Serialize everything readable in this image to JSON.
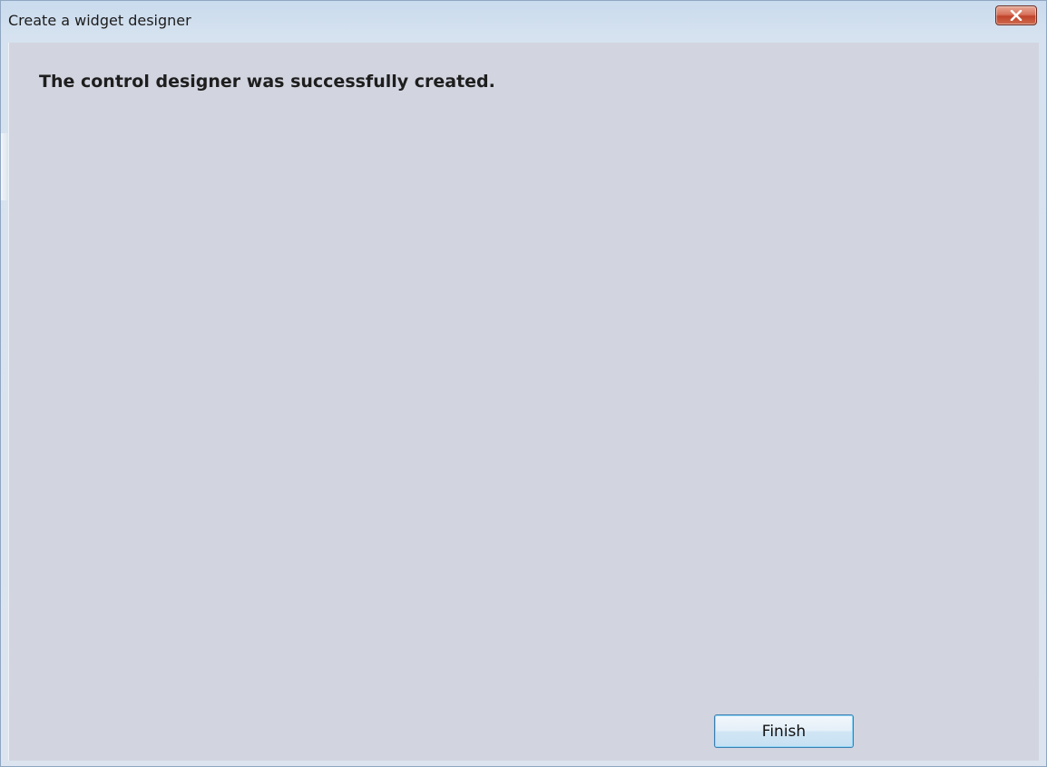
{
  "window": {
    "title": "Create a widget designer",
    "close_icon": "close-icon"
  },
  "content": {
    "message": "The control designer was successfully created."
  },
  "buttons": {
    "finish_label": "Finish"
  },
  "colors": {
    "client_background": "#d2d5e0",
    "close_button": "#c0432a",
    "button_border": "#3c7fb1"
  }
}
